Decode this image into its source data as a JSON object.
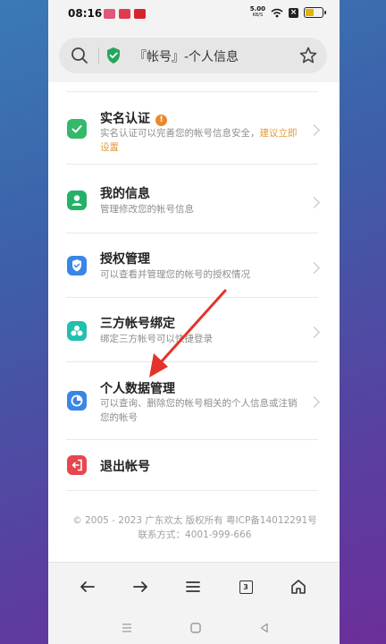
{
  "status": {
    "time": "08:16",
    "net_speed": "5.00",
    "net_unit": "KB/S",
    "app_icons": [
      {
        "name": "app-notif-1-icon",
        "color": "#e2567a",
        "text": ""
      },
      {
        "name": "app-notif-2-icon",
        "color": "#e03b4c",
        "text": ""
      },
      {
        "name": "app-notif-3-icon",
        "color": "#d8232c",
        "text": ""
      }
    ]
  },
  "search": {
    "title": "『帐号』-个人信息"
  },
  "items": [
    {
      "title": "实名认证",
      "desc": "实名认证可以完善您的帐号信息安全，",
      "desc_link": "建议立即设置",
      "color": "#34b86a",
      "icon": "verified-check-icon"
    },
    {
      "title": "我的信息",
      "desc": "管理修改您的帐号信息",
      "color": "#26b168",
      "icon": "user-icon"
    },
    {
      "title": "授权管理",
      "desc": "可以查看并管理您的帐号的授权情况",
      "color": "#3a86e6",
      "icon": "shield-check-icon"
    },
    {
      "title": "三方帐号绑定",
      "desc": "绑定三方帐号可以快捷登录",
      "color": "#23bfae",
      "icon": "link-circles-icon"
    },
    {
      "title": "个人数据管理",
      "desc": "可以查询、删除您的帐号相关的个人信息或注销您的帐号",
      "color": "#3a86e6",
      "icon": "data-pie-icon"
    },
    {
      "title": "退出帐号",
      "desc": "",
      "color": "#e8454f",
      "icon": "logout-icon"
    }
  ],
  "footer": {
    "text": "© 2005 - 2023 广东欢太 版权所有 粤ICP备14012291号 联系方式：4001-999-666"
  },
  "bottom_bar": {
    "tab_count": "3"
  },
  "colors": {
    "arrow": "#e4332a",
    "accent_orange": "#e39a3b"
  }
}
